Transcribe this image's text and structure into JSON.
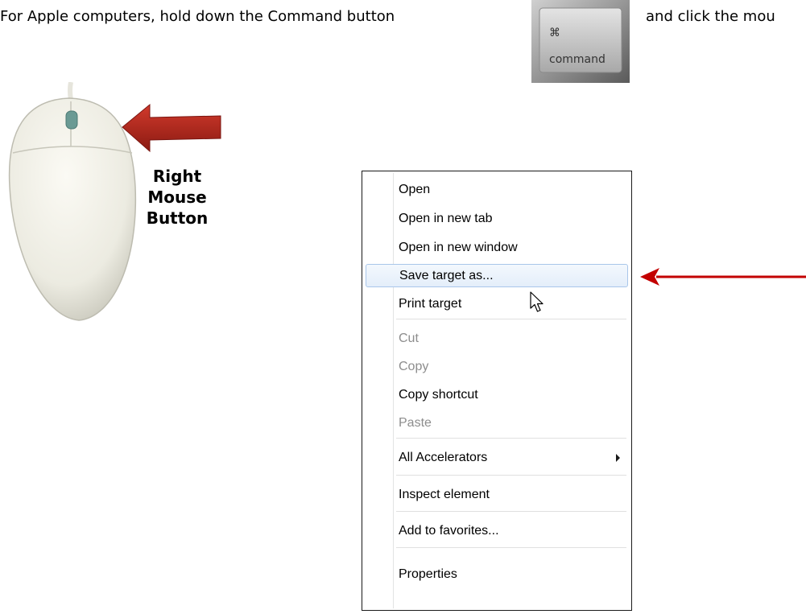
{
  "instruction": {
    "left_text": "For Apple computers, hold down the Command button",
    "right_text": "and click the mou"
  },
  "command_key": {
    "symbol": "⌘",
    "label": "command"
  },
  "mouse_caption": {
    "line1": "Right",
    "line2": "Mouse",
    "line3": "Button"
  },
  "context_menu": {
    "items": [
      {
        "label": "Open",
        "state": "normal"
      },
      {
        "label": "Open in new tab",
        "state": "normal"
      },
      {
        "label": "Open in new window",
        "state": "normal"
      },
      {
        "label": "Save target as...",
        "state": "highlighted"
      },
      {
        "label": "Print target",
        "state": "normal"
      },
      {
        "label": "Cut",
        "state": "disabled"
      },
      {
        "label": "Copy",
        "state": "disabled"
      },
      {
        "label": "Copy shortcut",
        "state": "normal"
      },
      {
        "label": "Paste",
        "state": "disabled"
      },
      {
        "label": "All Accelerators",
        "state": "normal"
      },
      {
        "label": "Inspect element",
        "state": "normal"
      },
      {
        "label": "Add to favorites...",
        "state": "normal"
      },
      {
        "label": "Properties",
        "state": "normal"
      }
    ]
  },
  "colors": {
    "callout_arrow": "#c30000",
    "mouse_arrow": "#b0241c",
    "highlight_border": "#a9c6ea",
    "disabled_text": "#8d8d8d"
  }
}
